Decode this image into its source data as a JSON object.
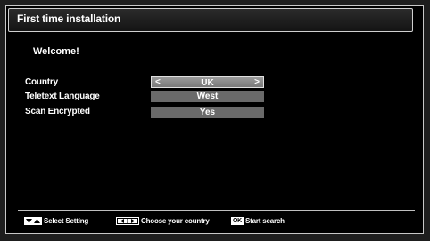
{
  "window": {
    "title": "First time installation"
  },
  "welcome": "Welcome!",
  "settings": [
    {
      "label": "Country",
      "value": "UK",
      "selected": true
    },
    {
      "label": "Teletext Language",
      "value": "West",
      "selected": false
    },
    {
      "label": "Scan Encrypted",
      "value": "Yes",
      "selected": false
    }
  ],
  "arrows": {
    "left": "<",
    "right": ">"
  },
  "footer": {
    "select_setting": "Select Setting",
    "choose_country": "Choose your country",
    "ok_key": "OK",
    "start_search": "Start search"
  },
  "colors": {
    "background": "#000000",
    "selected_value_bg": "#8c8c8c",
    "value_bg": "#6a6a6a",
    "text": "#ffffff"
  },
  "icons": [
    "up-down-keys-icon",
    "left-right-keys-icon",
    "ok-key-icon"
  ]
}
